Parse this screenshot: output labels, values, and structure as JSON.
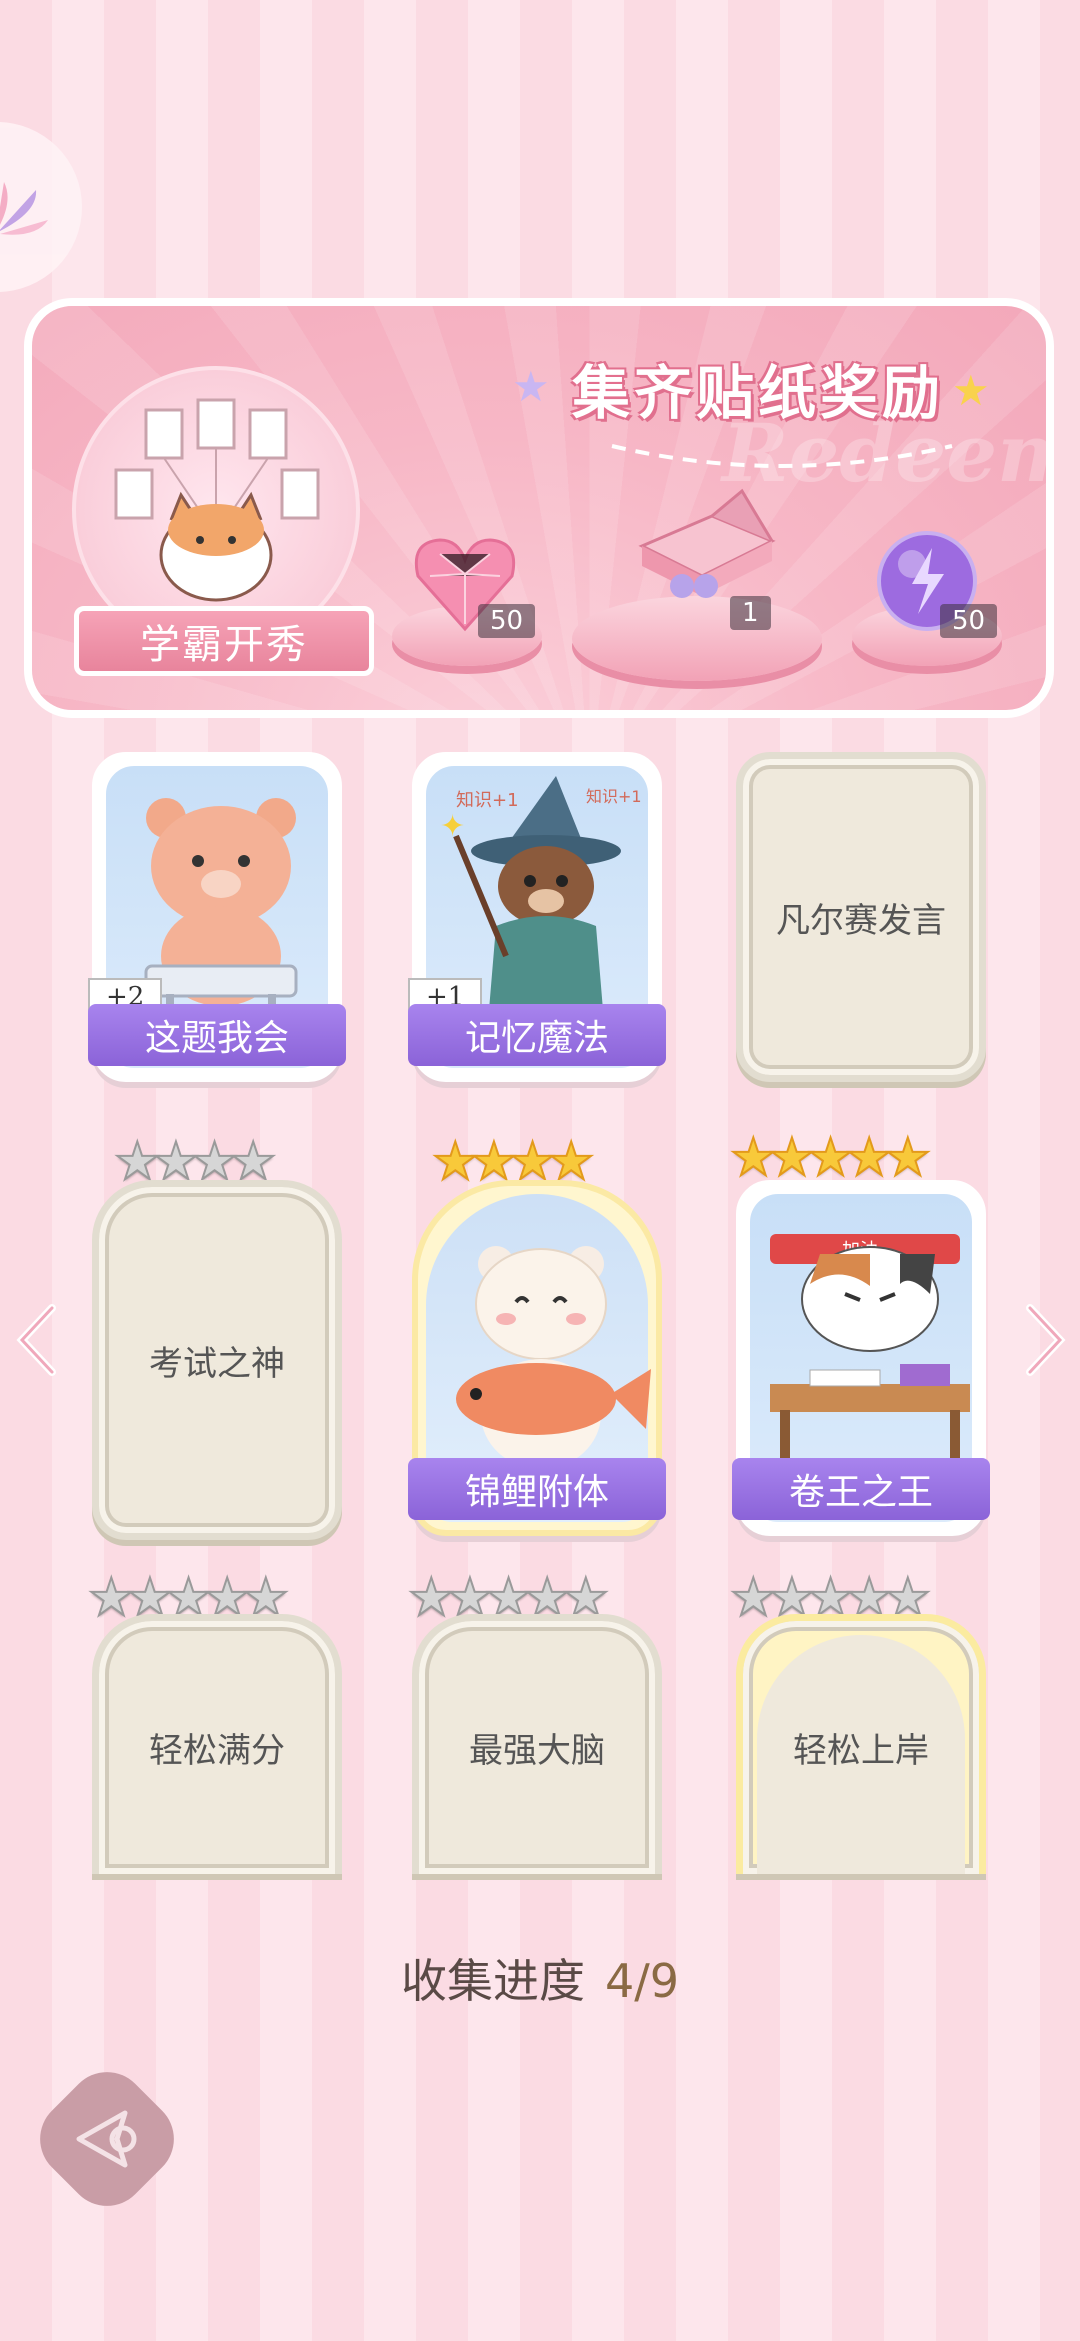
{
  "banner": {
    "title": "集齐贴纸奖励",
    "watermark": "Redeem",
    "avatar_label": "学霸开秀",
    "rewards": [
      {
        "icon": "pink-heart-gem-icon",
        "count": "50"
      },
      {
        "icon": "gift-box-icon",
        "count": "1"
      },
      {
        "icon": "lightning-orb-icon",
        "count": "50"
      }
    ]
  },
  "stickers": [
    {
      "name": "这题我会",
      "unlocked": true,
      "badge": "+2",
      "icon": "bear-at-desk-icon"
    },
    {
      "name": "记忆魔法",
      "unlocked": true,
      "badge": "+1",
      "icon": "wizard-otter-icon",
      "art_text": "知识+1"
    },
    {
      "name": "凡尔赛发言",
      "unlocked": false
    },
    {
      "name": "考试之神",
      "unlocked": false,
      "stars": 4
    },
    {
      "name": "锦鲤附体",
      "unlocked": true,
      "stars": 4,
      "icon": "bear-holding-koi-icon"
    },
    {
      "name": "卷王之王",
      "unlocked": true,
      "stars": 5,
      "icon": "cat-studying-icon",
      "art_text": "加油"
    },
    {
      "name": "轻松满分",
      "unlocked": false,
      "stars": 5
    },
    {
      "name": "最强大脑",
      "unlocked": false,
      "stars": 5
    },
    {
      "name": "轻松上岸",
      "unlocked": false,
      "stars": 5
    }
  ],
  "progress": {
    "label": "收集进度",
    "value": "4/9"
  }
}
